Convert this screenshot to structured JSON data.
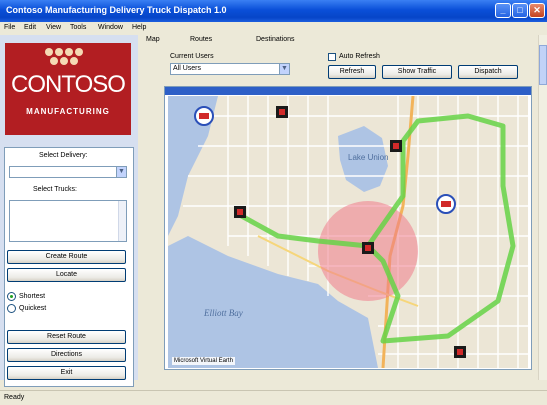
{
  "window": {
    "title": "Contoso Manufacturing Delivery Truck Dispatch 1.0",
    "minimize": "_",
    "maximize": "□",
    "close": "✕"
  },
  "menu": [
    "File",
    "Edit",
    "View",
    "Tools",
    "Window",
    "Help"
  ],
  "tabs": [
    "Map",
    "Routes",
    "Destinations"
  ],
  "logo": {
    "brand": "CONTOSO",
    "subtitle": "MANUFACTURING"
  },
  "left_panel": {
    "label_delivery": "Select Delivery:",
    "delivery_value": "",
    "label_trucks": "Select Trucks:",
    "trucks_value": "",
    "buttons": [
      "Create Route",
      "Locate"
    ],
    "radios": [
      {
        "label": "Shortest",
        "selected": true
      },
      {
        "label": "Quickest",
        "selected": false
      }
    ],
    "bottom_buttons": [
      "Reset Route",
      "Directions",
      "Exit"
    ]
  },
  "options": {
    "label_current": "Current Users",
    "combo_value": "All Users",
    "label_refresh": "Auto Refresh",
    "refresh_checked": false,
    "buttons": [
      "Refresh",
      "Show Traffic",
      "Dispatch"
    ]
  },
  "map": {
    "labels": [
      "Lake Union",
      "Elliott Bay"
    ],
    "scale": "Microsoft Virtual Earth"
  },
  "colors": {
    "titlebar": "#0a4fd8",
    "logo": "#b21e22",
    "route": "#66d246",
    "radius": "#f07c8c",
    "water": "#aec4e4",
    "land": "#ece6d6"
  },
  "status": "Ready"
}
